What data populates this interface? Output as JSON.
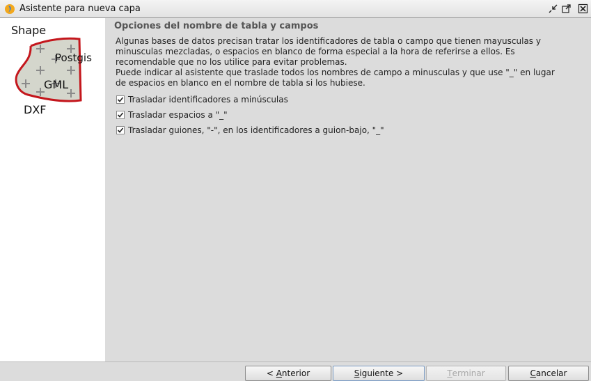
{
  "window": {
    "title": "Asistente para nueva capa"
  },
  "sidebar": {
    "labels": {
      "shape": "Shape",
      "postgis": "Postgis",
      "gml": "GML",
      "dxf": "DXF"
    },
    "colors": {
      "outline": "#c4161c",
      "fill": "#d4d6cc",
      "cross": "#8a8a8a"
    }
  },
  "main": {
    "section_title": "Opciones del nombre de tabla y campos",
    "description": [
      "Algunas bases de datos precisan tratar los identificadores de tabla o campo que tienen mayusculas y",
      "minusculas mezcladas, o espacios en blanco de forma especial a la hora de referirse a ellos. Es",
      "recomendable que no los utilice para evitar problemas.",
      "Puede indicar al asistente que traslade todos los nombres de campo a minusculas y que use \"_\" en lugar",
      "de espacios en blanco en el nombre de tabla si los hubiese."
    ],
    "options": [
      {
        "label": "Trasladar identificadores a minúsculas",
        "checked": true
      },
      {
        "label": "Trasladar espacios a \"_\"",
        "checked": true
      },
      {
        "label": "Trasladar guiones, \"-\", en los identificadores a guion-bajo, \"_\"",
        "checked": true
      }
    ]
  },
  "buttons": {
    "back": {
      "prefix": "< ",
      "mnemonic": "A",
      "rest": "nterior"
    },
    "next": {
      "mnemonic": "S",
      "rest": "iguiente >"
    },
    "finish": {
      "mnemonic": "T",
      "rest": "erminar",
      "enabled": false
    },
    "cancel": {
      "mnemonic": "C",
      "rest": "ancelar"
    }
  }
}
